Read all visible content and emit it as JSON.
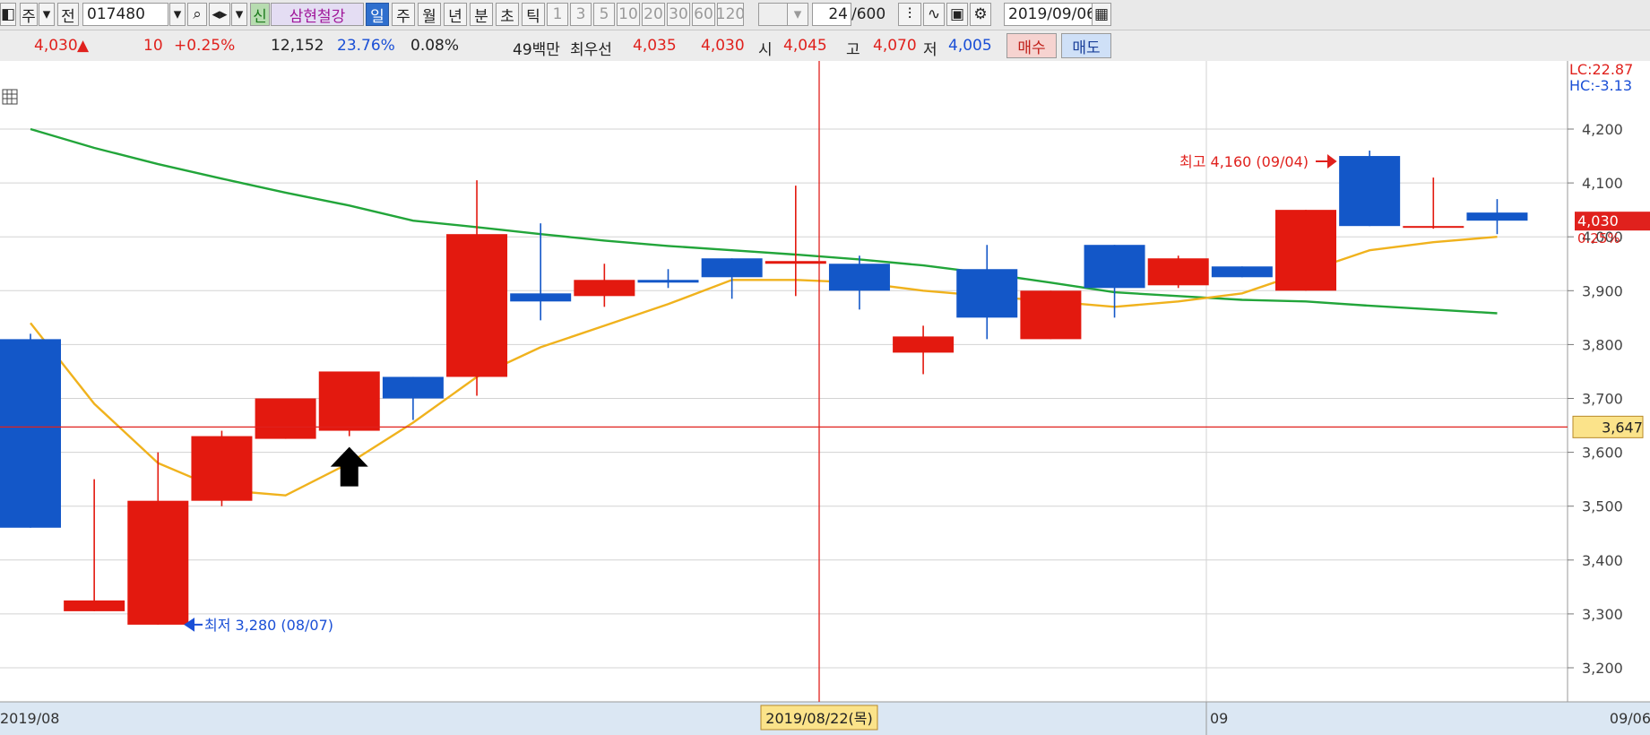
{
  "toolbar": {
    "type_label": "주",
    "market_label": "전",
    "code": "017480",
    "credit_badge": "신",
    "stock_name": "삼현철강",
    "period_tabs": [
      "일",
      "주",
      "월",
      "년",
      "분",
      "초",
      "틱"
    ],
    "selected_period": "일",
    "minute_options": [
      "1",
      "3",
      "5",
      "10",
      "20",
      "30",
      "60",
      "120"
    ],
    "count_value": "24",
    "count_total": "/600",
    "date": "2019/09/06"
  },
  "quote": {
    "price": "4,030",
    "direction": "▲",
    "change": "10",
    "change_pct": "+0.25%",
    "volume": "12,152",
    "volume_ratio": "23.76%",
    "turnover": "0.08%",
    "amount": "49백만",
    "best_label": "최우선",
    "best_ask": "4,035",
    "best_bid": "4,030",
    "open_label": "시",
    "open": "4,045",
    "high_label": "고",
    "high": "4,070",
    "low_label": "저",
    "low": "4,005",
    "buy_label": "매수",
    "sell_label": "매도"
  },
  "chart_data": {
    "type": "candlestick",
    "y_ticks": [
      "4,200",
      "4,100",
      "4,000",
      "3,900",
      "3,800",
      "3,700",
      "3,600",
      "3,500",
      "3,400",
      "3,300",
      "3,200"
    ],
    "ylim": [
      3130,
      4300
    ],
    "x_labels": [
      "2019/08",
      "09",
      "09/06"
    ],
    "crosshair_date": "2019/08/22(목)",
    "crosshair_price": "3,647",
    "current_price_label": "4,030",
    "current_pct_label": "0.25%",
    "lc_label": "LC:22.87",
    "hc_label": "HC:-3.13",
    "max_annotation": "최고 4,160 (09/04)",
    "min_annotation": "최저 3,280 (08/07)",
    "candles": [
      {
        "open": 3810,
        "high": 3820,
        "low": 3460,
        "close": 3460
      },
      {
        "open": 3305,
        "high": 3550,
        "low": 3305,
        "close": 3325
      },
      {
        "open": 3280,
        "high": 3600,
        "low": 3280,
        "close": 3510
      },
      {
        "open": 3510,
        "high": 3640,
        "low": 3500,
        "close": 3630
      },
      {
        "open": 3625,
        "high": 3700,
        "low": 3625,
        "close": 3700
      },
      {
        "open": 3640,
        "high": 3750,
        "low": 3630,
        "close": 3750
      },
      {
        "open": 3740,
        "high": 3740,
        "low": 3660,
        "close": 3700
      },
      {
        "open": 3740,
        "high": 4105,
        "low": 3705,
        "close": 4005
      },
      {
        "open": 3895,
        "high": 4025,
        "low": 3845,
        "close": 3880
      },
      {
        "open": 3890,
        "high": 3950,
        "low": 3870,
        "close": 3920
      },
      {
        "open": 3920,
        "high": 3940,
        "low": 3905,
        "close": 3915
      },
      {
        "open": 3960,
        "high": 3960,
        "low": 3885,
        "close": 3925
      },
      {
        "open": 3950,
        "high": 4095,
        "low": 3890,
        "close": 3955
      },
      {
        "open": 3950,
        "high": 3965,
        "low": 3865,
        "close": 3900
      },
      {
        "open": 3785,
        "high": 3835,
        "low": 3745,
        "close": 3815
      },
      {
        "open": 3940,
        "high": 3985,
        "low": 3810,
        "close": 3850
      },
      {
        "open": 3810,
        "high": 3900,
        "low": 3810,
        "close": 3900
      },
      {
        "open": 3985,
        "high": 3985,
        "low": 3850,
        "close": 3905
      },
      {
        "open": 3910,
        "high": 3965,
        "low": 3905,
        "close": 3960
      },
      {
        "open": 3945,
        "high": 3945,
        "low": 3925,
        "close": 3925
      },
      {
        "open": 3900,
        "high": 4050,
        "low": 3900,
        "close": 4050
      },
      {
        "open": 4150,
        "high": 4160,
        "low": 4020,
        "close": 4020
      },
      {
        "open": 4020,
        "high": 4110,
        "low": 4015,
        "close": 4020
      },
      {
        "open": 4045,
        "high": 4070,
        "low": 4005,
        "close": 4030
      }
    ],
    "ma_short": [
      3840,
      3690,
      3580,
      3530,
      3520,
      3580,
      3655,
      3740,
      3795,
      3835,
      3875,
      3920,
      3920,
      3915,
      3900,
      3890,
      3880,
      3870,
      3880,
      3895,
      3935,
      3975,
      3990,
      4000
    ],
    "ma_long": [
      4200,
      4165,
      4135,
      4108,
      4082,
      4058,
      4030,
      4018,
      4005,
      3993,
      3983,
      3975,
      3967,
      3958,
      3947,
      3932,
      3915,
      3897,
      3890,
      3883,
      3880,
      3872,
      3865,
      3858
    ]
  }
}
